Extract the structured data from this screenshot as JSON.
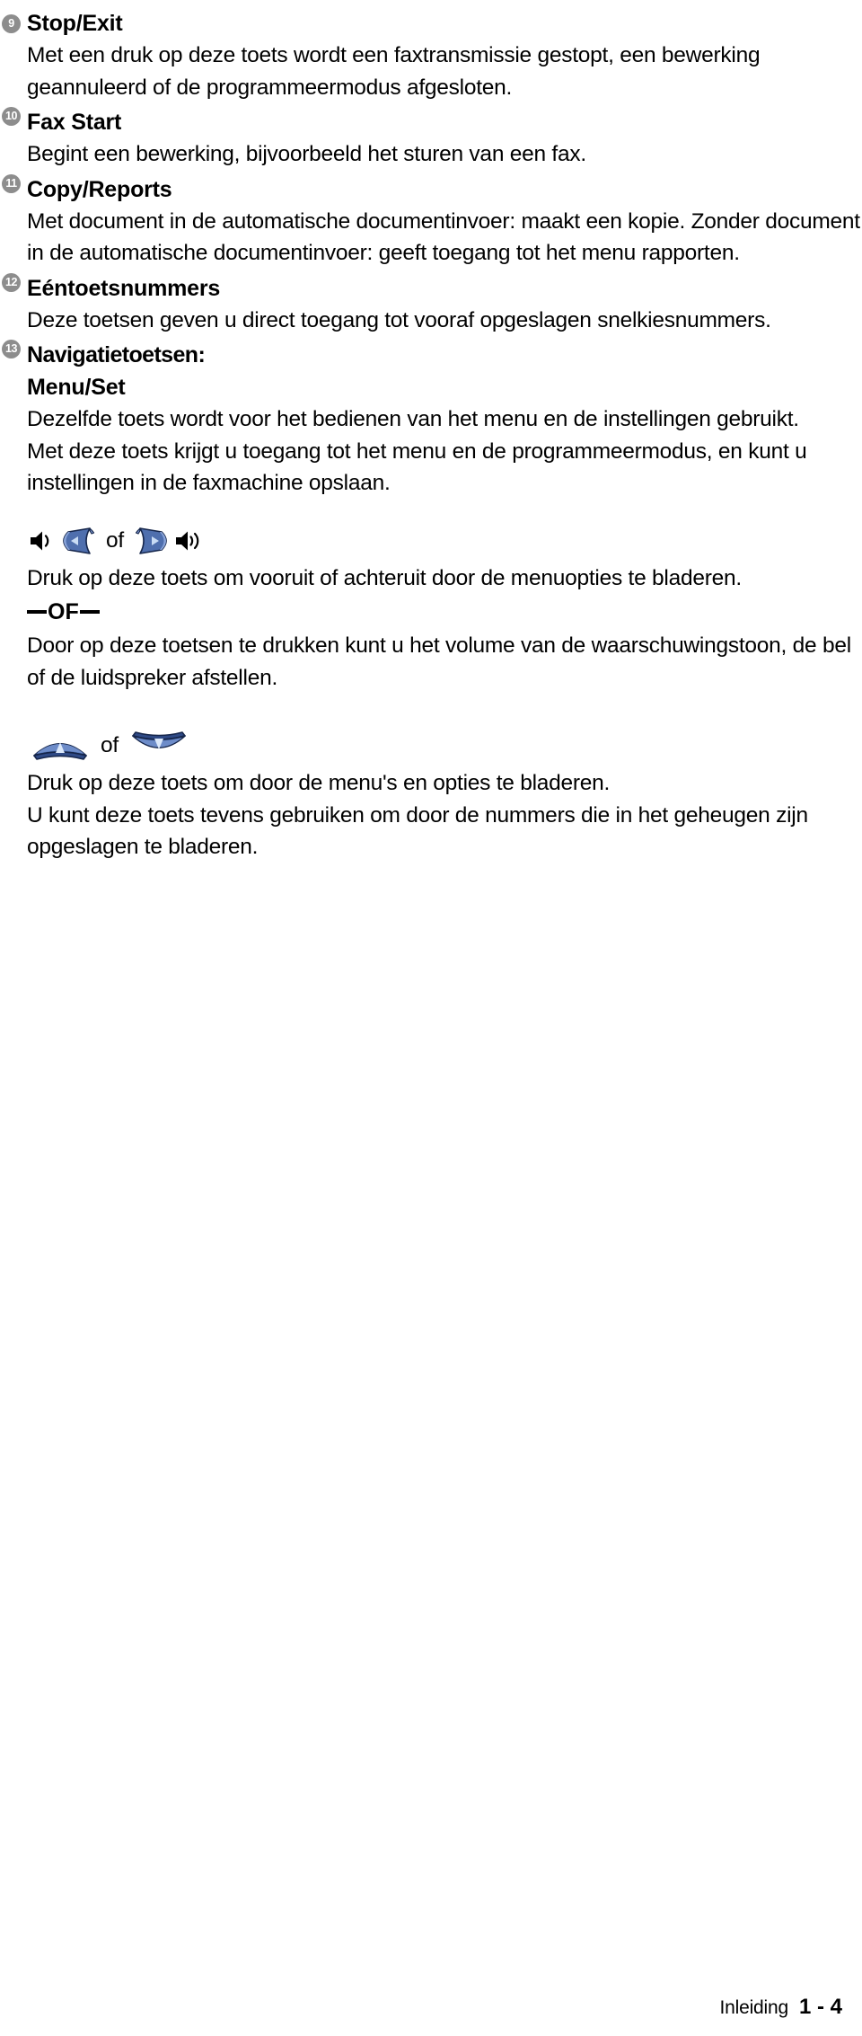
{
  "document": {
    "language": "nl",
    "entries": [
      {
        "number": "9",
        "title": "Stop/Exit",
        "paragraphs": [
          "Met een druk op deze toets wordt een faxtransmissie gestopt, een bewerking geannuleerd of de programmeermodus afgesloten."
        ]
      },
      {
        "number": "10",
        "title": "Fax Start",
        "paragraphs": [
          "Begint een bewerking, bijvoorbeeld het sturen van een fax."
        ]
      },
      {
        "number": "11",
        "title": "Copy/Reports",
        "paragraphs": [
          "Met document in de automatische documentinvoer: maakt een kopie. Zonder document in de automatische documentinvoer: geeft toegang tot het menu rapporten."
        ]
      },
      {
        "number": "12",
        "title": "Eéntoetsnummers",
        "paragraphs": [
          "Deze toetsen geven u direct toegang tot vooraf opgeslagen snelkiesnummers."
        ]
      },
      {
        "number": "13",
        "title": "Navigatietoetsen:",
        "subtitle": "Menu/Set",
        "paragraphs": [
          "Dezelfde toets wordt voor het bedienen van het menu en de instellingen gebruikt.",
          "Met deze toets krijgt u toegang tot het menu en de programmeermodus, en kunt u instellingen in de faxmachine opslaan."
        ]
      }
    ],
    "left_right_block": {
      "icons": {
        "speaker_low": "speaker-low-icon",
        "left_arrow_key": "left-arrow-key-icon",
        "right_arrow_key": "right-arrow-key-icon",
        "speaker_high": "speaker-high-icon"
      },
      "separator": "of",
      "paragraphs": [
        "Druk op deze toets om vooruit of achteruit door de menuopties te bladeren."
      ],
      "divider_text": "OF",
      "paragraphs_after": [
        "Door op deze toetsen te drukken kunt u het volume van de waarschuwingstoon, de bel of de luidspreker afstellen."
      ]
    },
    "up_down_block": {
      "icons": {
        "up_arrow_key": "up-arrow-key-icon",
        "down_arrow_key": "down-arrow-key-icon"
      },
      "separator": "of",
      "paragraphs": [
        "Druk op deze toets om door de menu's en opties te bladeren.",
        "U kunt deze toets tevens gebruiken om door de nummers die in het geheugen zijn opgeslagen te bladeren."
      ]
    },
    "footer": {
      "label": "Inleiding",
      "page": "1 - 4"
    },
    "colors": {
      "badge_gray": "#8d8d8d",
      "key_blue": "#5b7fc0",
      "key_blue_dark": "#2a4a8a",
      "text_black": "#000000"
    }
  }
}
